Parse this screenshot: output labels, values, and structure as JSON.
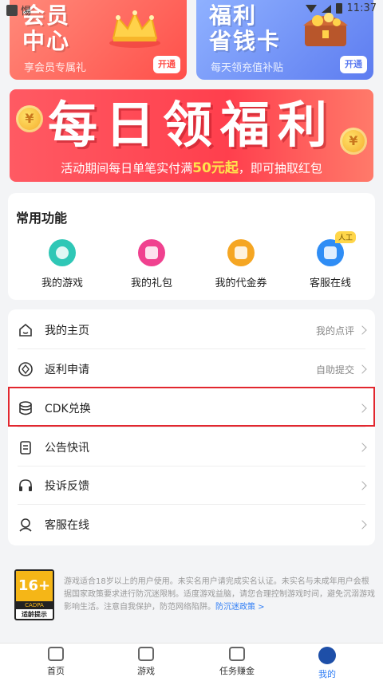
{
  "status_bar": {
    "time": "11:37",
    "glyph": "惕"
  },
  "top_cards": {
    "vip": {
      "title_line1": "会员",
      "title_line2": "中心",
      "subtitle": "享会员专属礼",
      "button": "开通"
    },
    "save": {
      "title_line1": "福利",
      "title_line2": "省钱卡",
      "subtitle": "每天领充值补贴",
      "button": "开通"
    }
  },
  "banner": {
    "title": "每日领福利",
    "sub_prefix": "活动期间每日单笔实付满",
    "sub_highlight": "50元起",
    "sub_suffix": "，即可抽取红包",
    "coin_symbol": "¥"
  },
  "common_functions": {
    "title": "常用功能",
    "items": [
      {
        "label": "我的游戏",
        "icon": "game-icon"
      },
      {
        "label": "我的礼包",
        "icon": "gift-icon"
      },
      {
        "label": "我的代金券",
        "icon": "coupon-icon"
      },
      {
        "label": "客服在线",
        "icon": "service-icon"
      }
    ],
    "badge": "人工"
  },
  "menu": {
    "items": [
      {
        "label": "我的主页",
        "right": "我的点评",
        "icon": "home-icon"
      },
      {
        "label": "返利申请",
        "right": "自助提交",
        "icon": "rebate-icon"
      },
      {
        "label": "CDK兑换",
        "right": "",
        "icon": "database-icon"
      },
      {
        "label": "公告快讯",
        "right": "",
        "icon": "notice-icon"
      },
      {
        "label": "投诉反馈",
        "right": "",
        "icon": "headset-icon"
      },
      {
        "label": "客服在线",
        "right": "",
        "icon": "support-icon"
      }
    ]
  },
  "disclaimer": {
    "age_number": "16+",
    "age_org": "CADPA",
    "age_caption": "适龄提示",
    "text": "游戏适合18岁以上的用户使用。未实名用户请完成实名认证。未实名与未成年用户会根据国家政策要求进行防沉迷限制。适度游戏益脑，请您合理控制游戏时间，避免沉溺游戏影响生活。注意自我保护，防范网络陷阱。",
    "link": "防沉迷政策 >"
  },
  "tabbar": {
    "tabs": [
      {
        "label": "首页"
      },
      {
        "label": "游戏"
      },
      {
        "label": "任务赚金"
      },
      {
        "label": "我的"
      }
    ],
    "active_index": 3,
    "active_color": "#2f7df5"
  }
}
